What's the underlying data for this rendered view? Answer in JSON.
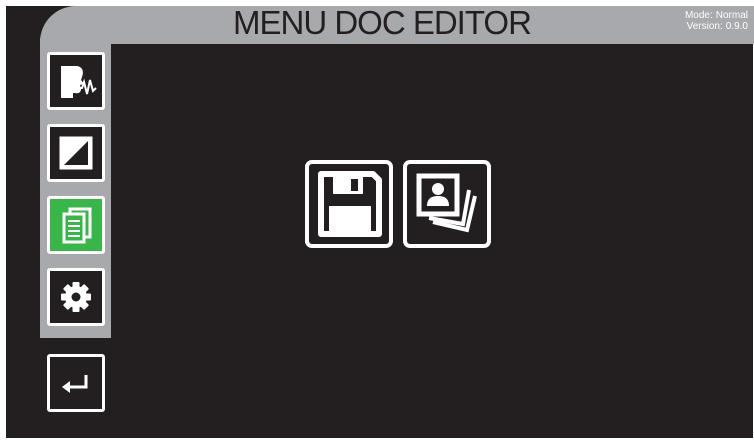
{
  "header": {
    "title": "MENU DOC EDITOR",
    "mode_label": "Mode:",
    "mode_value": "Normal",
    "version_label": "Version:",
    "version_value": "0.9.0"
  },
  "sidebar": {
    "items": [
      {
        "icon": "voice-wave-icon",
        "active": false
      },
      {
        "icon": "contrast-icon",
        "active": false
      },
      {
        "icon": "documents-icon",
        "active": true
      },
      {
        "icon": "gear-icon",
        "active": false
      }
    ]
  },
  "main": {
    "actions": [
      {
        "icon": "floppy-disk-icon"
      },
      {
        "icon": "photo-stack-icon"
      }
    ]
  },
  "back": {
    "icon": "return-arrow-icon"
  },
  "colors": {
    "screen_bg": "#231f20",
    "panel_gray": "#a7a9ac",
    "active_green": "#39b54a",
    "border_white": "#ffffff"
  }
}
